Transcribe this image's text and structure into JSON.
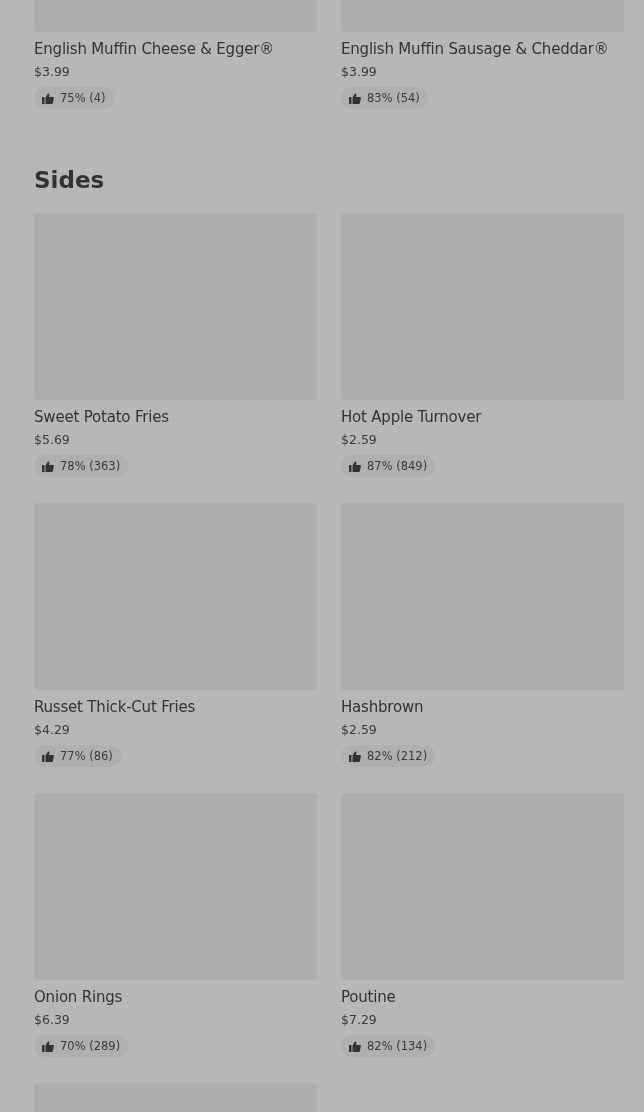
{
  "sections": [
    {
      "items": [
        {
          "kind": "dish",
          "name": "English Muffin Cheese & Egger®",
          "price": "$3.99",
          "rating": "75% (4)"
        },
        {
          "kind": "dish",
          "name": "English Muffin Sausage & Cheddar®",
          "price": "$3.99",
          "rating": "83% (54)"
        }
      ]
    },
    {
      "title": "Sides",
      "items": [
        {
          "kind": "dish",
          "name": "Sweet Potato Fries",
          "price": "$5.69",
          "rating": "78% (363)"
        },
        {
          "kind": "dish",
          "name": "Hot Apple Turnover",
          "price": "$2.59",
          "rating": "87% (849)"
        },
        {
          "kind": "dish",
          "name": "Russet Thick-Cut Fries",
          "price": "$4.29",
          "rating": "77% (86)"
        },
        {
          "kind": "dish",
          "name": "Hashbrown",
          "price": "$2.59",
          "rating": "82% (212)"
        },
        {
          "kind": "dish",
          "name": "Onion Rings",
          "price": "$6.39",
          "rating": "70% (289)"
        },
        {
          "kind": "dish",
          "name": "Poutine",
          "price": "$7.29",
          "rating": "82% (134)"
        },
        {
          "kind": "image"
        }
      ]
    }
  ]
}
